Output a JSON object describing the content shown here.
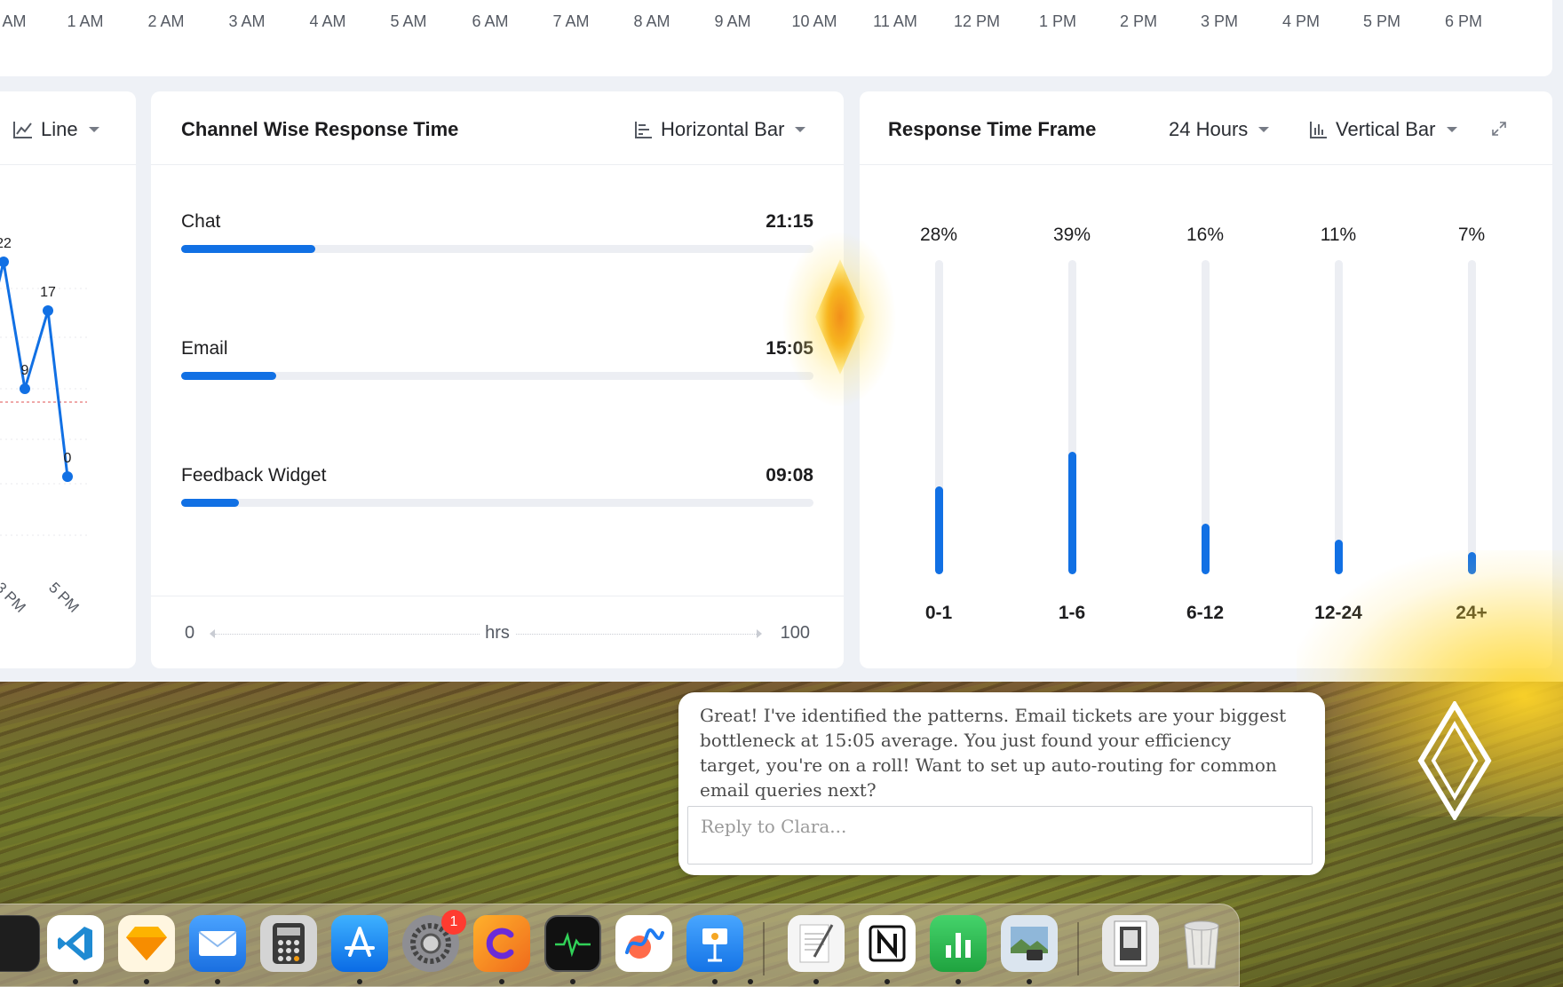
{
  "timeline": {
    "ticks": [
      "AM",
      "1 AM",
      "2 AM",
      "3 AM",
      "4 AM",
      "5 AM",
      "6 AM",
      "7 AM",
      "8 AM",
      "9 AM",
      "10 AM",
      "11 AM",
      "12 PM",
      "1 PM",
      "2 PM",
      "3 PM",
      "4 PM",
      "5 PM",
      "6 PM"
    ]
  },
  "left_card": {
    "chart_type_label": "Line",
    "point_labels": [
      "22",
      "9",
      "17",
      "0"
    ],
    "x_labels": [
      "3 PM",
      "5 PM"
    ]
  },
  "channel_card": {
    "title": "Channel Wise Response Time",
    "chart_type_label": "Horizontal Bar",
    "axis_min": "0",
    "axis_max": "100",
    "axis_unit": "hrs"
  },
  "frame_card": {
    "title": "Response Time Frame",
    "range_label": "24 Hours",
    "chart_type_label": "Vertical Bar"
  },
  "chart_data": [
    {
      "type": "line",
      "x": [
        "",
        "",
        "3 PM",
        "",
        "5 PM"
      ],
      "values": [
        22,
        9,
        17,
        0
      ],
      "xlabel": "",
      "ylabel": ""
    },
    {
      "type": "bar",
      "orientation": "horizontal",
      "categories": [
        "Chat",
        "Email",
        "Feedback Widget"
      ],
      "value_labels": [
        "21:15",
        "15:05",
        "09:08"
      ],
      "values": [
        21.25,
        15.08,
        9.13
      ],
      "xlim": [
        0,
        100
      ],
      "xlabel": "hrs"
    },
    {
      "type": "bar",
      "orientation": "vertical",
      "categories": [
        "0-1",
        "1-6",
        "6-12",
        "12-24",
        "24+"
      ],
      "value_labels": [
        "28%",
        "39%",
        "16%",
        "11%",
        "7%"
      ],
      "values": [
        28,
        39,
        16,
        11,
        7
      ],
      "ylim": [
        0,
        100
      ]
    }
  ],
  "chat": {
    "message": "Great! I've identified the patterns. Email tickets are your biggest bottleneck at 15:05 average. You just found your efficiency target, you're on a roll! Want to set up auto-routing for common email queries next?",
    "input_placeholder": "Reply to Clara..."
  },
  "dock": {
    "apps": [
      {
        "name": "terminal",
        "color": "#1e1e1e"
      },
      {
        "name": "vscode",
        "color": "#ffffff"
      },
      {
        "name": "sketch",
        "color": "#fff6e0"
      },
      {
        "name": "mail",
        "color": "#3a8ef5"
      },
      {
        "name": "calculator",
        "color": "#d8d8d8"
      },
      {
        "name": "app-store",
        "color": "#1d8df5"
      },
      {
        "name": "system-settings",
        "color": "#8e8e93",
        "badge": "1"
      },
      {
        "name": "app-c",
        "color": "#f5951d"
      },
      {
        "name": "activity-monitor",
        "color": "#1a1a1a"
      },
      {
        "name": "freeform",
        "color": "#ffffff"
      },
      {
        "name": "keynote",
        "color": "#2e8cf0"
      },
      {
        "name": "textedit",
        "color": "#f5f5f5"
      },
      {
        "name": "notion",
        "color": "#ffffff"
      },
      {
        "name": "numbers",
        "color": "#2fb54a"
      },
      {
        "name": "preview",
        "color": "#dbe5ef"
      },
      {
        "name": "downloads",
        "color": "#e8e8e8"
      },
      {
        "name": "trash",
        "color": "#e6e6e6"
      }
    ],
    "badge": "1"
  },
  "colors": {
    "accent": "#1170e4",
    "track": "#eceef3",
    "glow": "#f7b51f"
  }
}
